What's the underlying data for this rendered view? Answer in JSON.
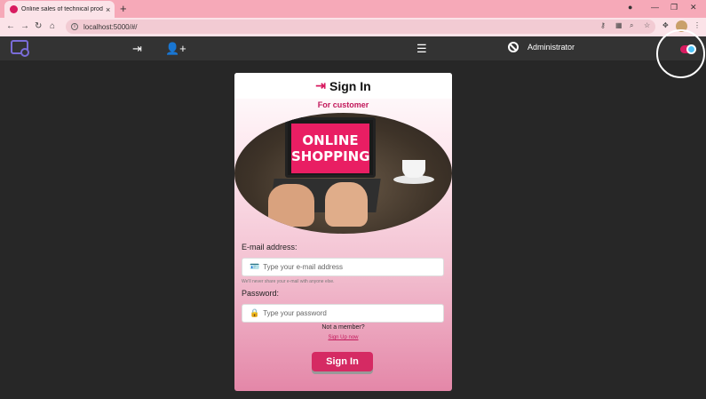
{
  "browser": {
    "tab_title": "Online sales of technical products",
    "close_glyph": "×",
    "new_tab_glyph": "+",
    "url": "localhost:5000/#/"
  },
  "appnav": {
    "admin_label": "Administrator",
    "icons": [
      "login-icon",
      "add-user-icon",
      "list-icon",
      "ban-icon"
    ]
  },
  "card": {
    "title": "Sign In",
    "subtitle": "For customer",
    "image_text_line1": "ONLINE",
    "image_text_line2": "SHOPPING",
    "email": {
      "label": "E-mail address:",
      "placeholder": "Type your e-mail address",
      "helper": "We'll never share your e-mail with anyone else."
    },
    "password": {
      "label": "Password:",
      "placeholder": "Type your password"
    },
    "not_member": "Not a member?",
    "signup_link": "Sign Up now",
    "submit": "Sign In"
  },
  "colors": {
    "accent": "#d81b60",
    "nav_bg": "#333333",
    "page_bg": "#272727",
    "tab_bar": "#f6a9b8"
  }
}
